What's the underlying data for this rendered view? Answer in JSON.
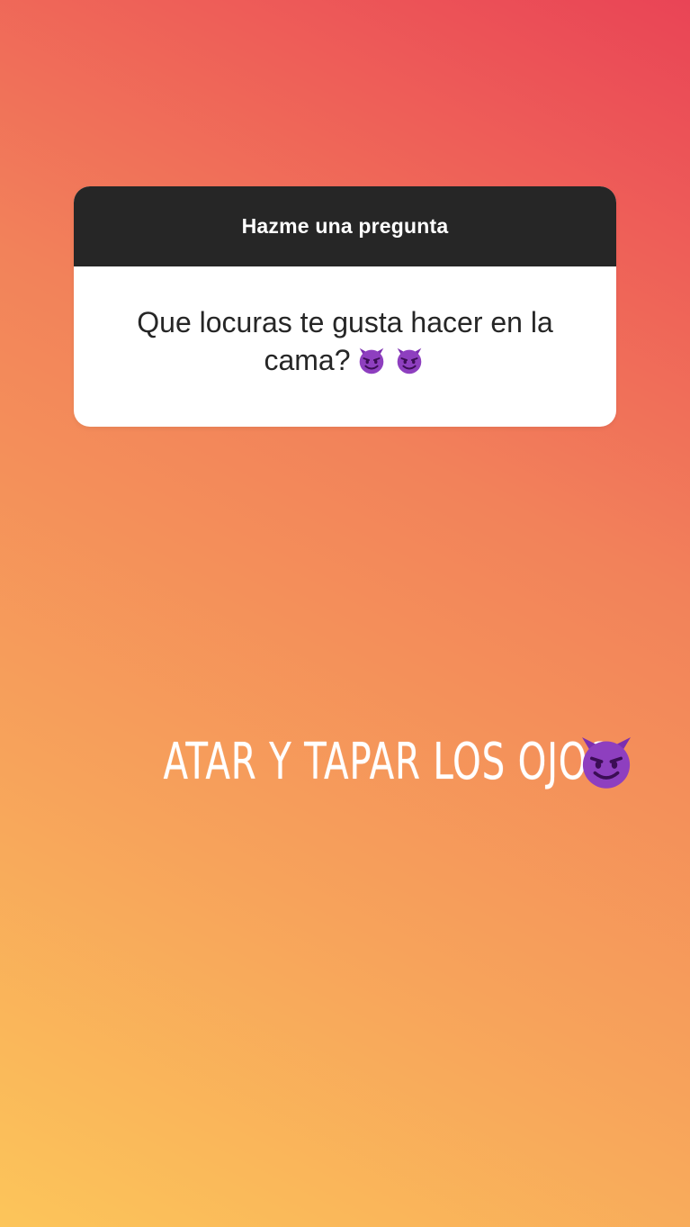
{
  "story": {
    "background_colors": [
      "#fcc55a",
      "#f7a35b",
      "#f2825a",
      "#ee5e58",
      "#e94456"
    ]
  },
  "question_sticker": {
    "header_label": "Hazme una pregunta",
    "question_line_1": "Que locuras te gusta hacer en la",
    "question_line_2": "cama?",
    "emoji_icons": [
      "smiling-devil-icon",
      "smiling-devil-icon"
    ],
    "header_color": "#262626"
  },
  "answer": {
    "text": "ATAR Y TAPAR LOS OJOS",
    "emoji_icon": "smiling-devil-icon",
    "emoji_color": "#8e3fbf"
  }
}
